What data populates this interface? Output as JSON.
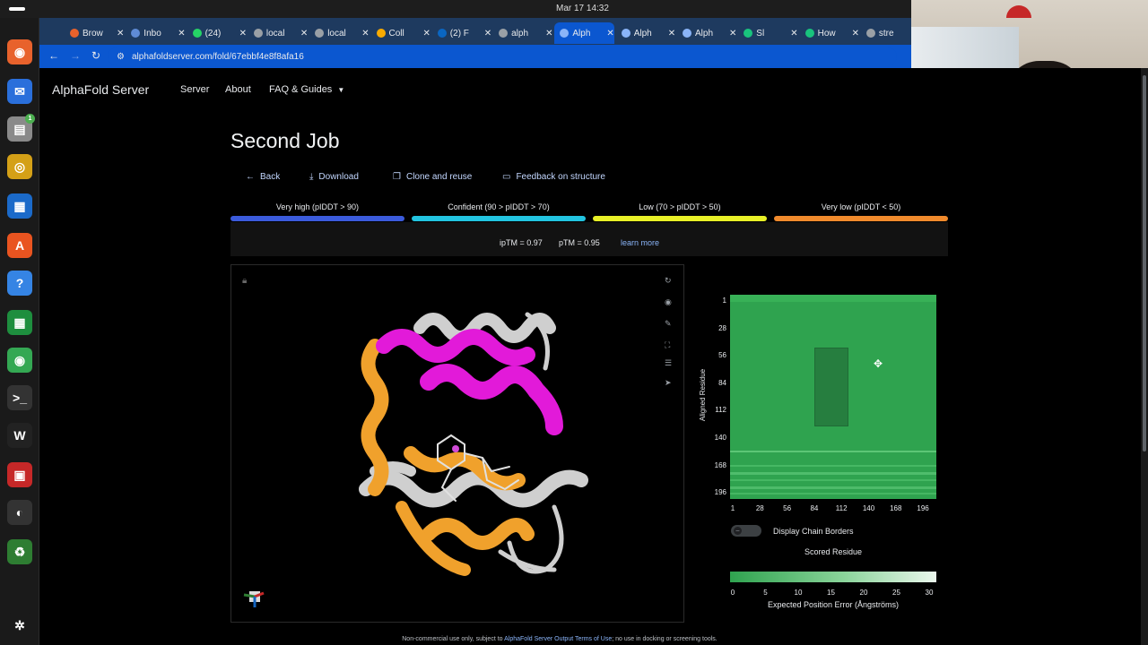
{
  "system": {
    "clock": "Mar 17  14:32"
  },
  "dock": {
    "items": [
      {
        "name": "firefox",
        "glyph": "◉",
        "color": "#e8622c"
      },
      {
        "name": "thunderbird",
        "glyph": "✉",
        "color": "#2a6fdb"
      },
      {
        "name": "files",
        "glyph": "▤",
        "color": "#8a8a8a",
        "badge": "1"
      },
      {
        "name": "rhythmbox",
        "glyph": "◎",
        "color": "#d4a017"
      },
      {
        "name": "writer",
        "glyph": "▦",
        "color": "#1b6ac9"
      },
      {
        "name": "app-center",
        "glyph": "A",
        "color": "#e95420"
      },
      {
        "name": "help",
        "glyph": "?",
        "color": "#3584e4"
      },
      {
        "name": "calc",
        "glyph": "▦",
        "color": "#1e8e3e"
      },
      {
        "name": "chrome",
        "glyph": "◉",
        "color": "#34a853"
      },
      {
        "name": "terminal",
        "glyph": ">_",
        "color": "#333333"
      },
      {
        "name": "wps",
        "glyph": "W",
        "color": "#222222"
      },
      {
        "name": "document-viewer",
        "glyph": "▣",
        "color": "#c62828"
      },
      {
        "name": "obs",
        "glyph": "◐",
        "color": "#333333"
      },
      {
        "name": "trash",
        "glyph": "♻",
        "color": "#2e7d32"
      },
      {
        "name": "show-apps",
        "glyph": "✲",
        "color": "#1a1a1a"
      }
    ]
  },
  "browser": {
    "tabs": [
      {
        "label": "Brow",
        "fav": "#e8622c"
      },
      {
        "label": "Inbo",
        "fav": "#5f8bd6"
      },
      {
        "label": "(24)",
        "fav": "#25d366"
      },
      {
        "label": "local",
        "fav": "#9aa0a6"
      },
      {
        "label": "local",
        "fav": "#9aa0a6"
      },
      {
        "label": "Coll",
        "fav": "#f9ab00"
      },
      {
        "label": "(2) F",
        "fav": "#0a66c2"
      },
      {
        "label": "alph",
        "fav": "#9aa0a6"
      },
      {
        "label": "Alph",
        "fav": "#8ab4f8",
        "active": true
      },
      {
        "label": "Alph",
        "fav": "#8ab4f8"
      },
      {
        "label": "Alph",
        "fav": "#8ab4f8"
      },
      {
        "label": "Sl",
        "fav": "#19c37d"
      },
      {
        "label": "How",
        "fav": "#19c37d"
      },
      {
        "label": "stre",
        "fav": "#9aa0a6"
      }
    ],
    "url": "alphafoldserver.com/fold/67ebbf4e8f8afa16"
  },
  "site": {
    "title": "AlphaFold Server",
    "nav": [
      "Server",
      "About",
      "FAQ & Guides"
    ]
  },
  "job": {
    "title": "Second Job",
    "actions": {
      "back": "Back",
      "download": "Download",
      "clone": "Clone and reuse",
      "feedback": "Feedback on structure"
    }
  },
  "confidence_legend": [
    {
      "label": "Very high (pIDDT > 90)",
      "color": "#3b5bdb"
    },
    {
      "label": "Confident (90 > pIDDT > 70)",
      "color": "#22c4e0"
    },
    {
      "label": "Low (70 > pIDDT > 50)",
      "color": "#e8f027"
    },
    {
      "label": "Very low (pIDDT < 50)",
      "color": "#f08a2c"
    }
  ],
  "scores": {
    "iptm": "ipTM = 0.97",
    "ptm": "pTM = 0.95",
    "learn_more": "learn more"
  },
  "pae": {
    "y_label": "Aligned Residue",
    "x_label": "Scored Residue",
    "ticks": [
      "1",
      "28",
      "56",
      "84",
      "112",
      "140",
      "168",
      "196"
    ],
    "toggle_label": "Display Chain Borders",
    "toggle_on": false,
    "colorbar_ticks": [
      "0",
      "5",
      "10",
      "15",
      "20",
      "25",
      "30"
    ],
    "colorbar_label": "Expected Position Error (Ångströms)",
    "colors": {
      "low": "#2fa34f",
      "high": "#eaf7ec"
    }
  },
  "footer": {
    "pre": "Non-commercial use only, subject to ",
    "link": "AlphaFold Server Output Terms of Use",
    "post": "; no use in docking or screening tools."
  }
}
